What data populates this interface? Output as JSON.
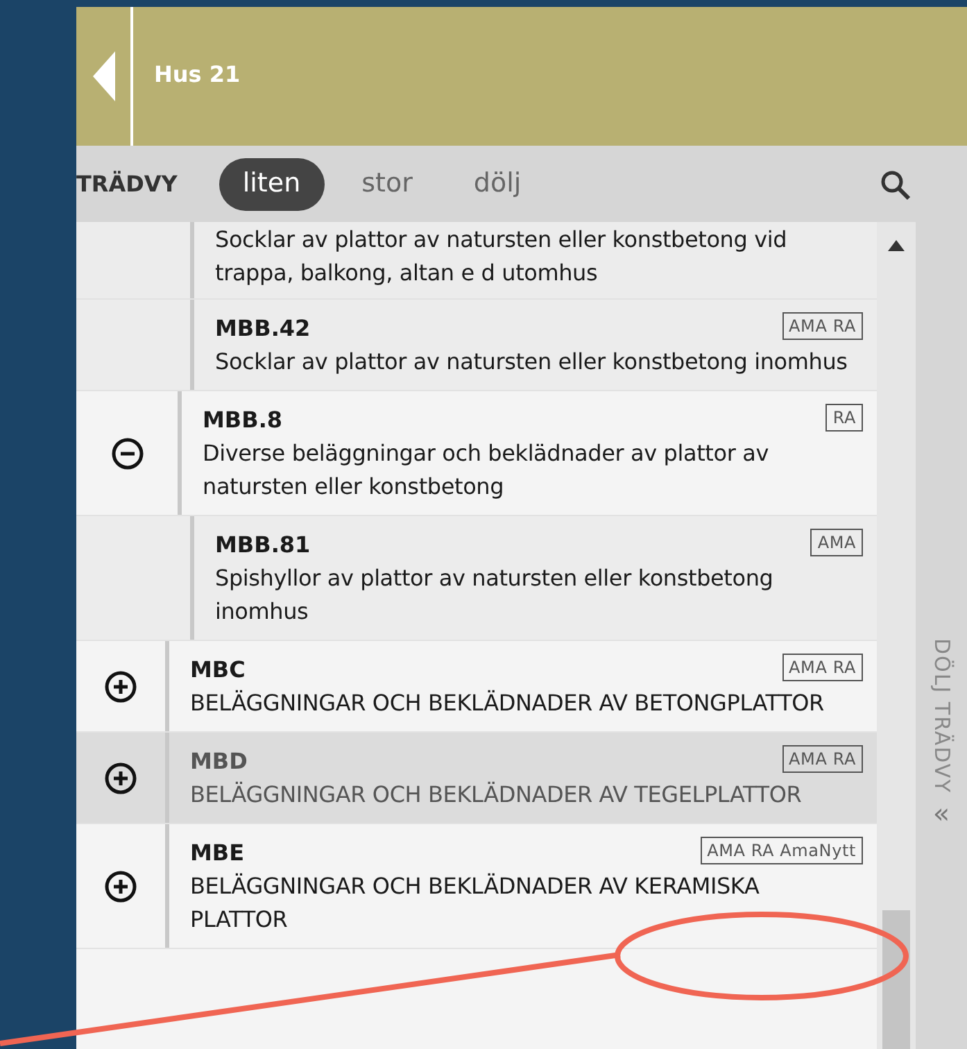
{
  "header": {
    "title": "Hus 21"
  },
  "toolbar": {
    "label": "TRÄDVY",
    "size_options": [
      {
        "label": "liten",
        "selected": true
      },
      {
        "label": "stor",
        "selected": false
      },
      {
        "label": "dölj",
        "selected": false
      }
    ]
  },
  "tree": [
    {
      "children": [
        {
          "children": [
            {
              "description": "Socklar av plattor av natursten eller konstbetong vid trappa, balkong, altan e d utomhus",
              "selected": false
            },
            {
              "code": "MBB.42",
              "description": "Socklar av plattor av natursten eller konstbetong inomhus",
              "badges": [
                "AMA RA"
              ],
              "selected": false
            }
          ]
        },
        {
          "code": "MBB.8",
          "description": "Diverse beläggningar och beklädnader av plattor av natursten eller konstbetong",
          "badges": [
            "RA"
          ],
          "expanded": true,
          "selected": false,
          "children": [
            {
              "code": "MBB.81",
              "description": "Spishyllor av plattor av natursten eller konstbetong inomhus",
              "badges": [
                "AMA"
              ],
              "selected": false
            }
          ]
        }
      ]
    },
    {
      "code": "MBC",
      "description": "BELÄGGNINGAR OCH BEKLÄDNADER AV BETONGPLATTOR",
      "badges": [
        "AMA RA"
      ],
      "expanded": false,
      "selected": false
    },
    {
      "code": "MBD",
      "description": "BELÄGGNINGAR OCH BEKLÄDNADER AV TEGELPLATTOR",
      "badges": [
        "AMA RA"
      ],
      "expanded": false,
      "selected": true
    },
    {
      "code": "MBE",
      "description": "BELÄGGNINGAR OCH BEKLÄDNADER AV KERAMISKA PLATTOR",
      "badges": [
        "AMA RA AmaNytt"
      ],
      "expanded": false,
      "selected": false
    }
  ],
  "side_panel": {
    "label": "DÖLJ TRÄDVY",
    "icon_text": "«"
  }
}
